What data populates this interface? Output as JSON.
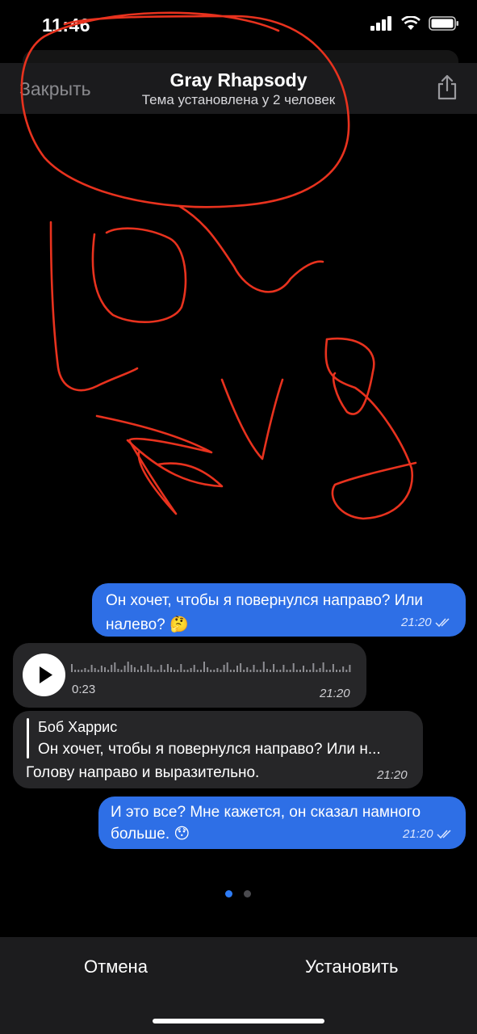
{
  "status_bar": {
    "time": "11:46"
  },
  "header": {
    "close_label": "Закрыть",
    "title": "Gray Rhapsody",
    "subtitle": "Тема установлена у 2 человек"
  },
  "messages": {
    "m1": {
      "text": "Он хочет, чтобы я повернулся направо? Или налево? 🤔",
      "time": "21:20"
    },
    "voice": {
      "duration": "0:23",
      "time": "21:20"
    },
    "reply": {
      "author": "Боб Харрис",
      "quote": "Он хочет, чтобы я повернулся направо? Или н...",
      "text": "Голову направо и выразительно.",
      "time": "21:20"
    },
    "m2": {
      "text": "И это все? Мне кажется, он сказал намного больше. 😯",
      "time": "21:20"
    }
  },
  "pager": {
    "page": 1,
    "total": 2
  },
  "bottom": {
    "cancel_label": "Отмена",
    "set_label": "Установить"
  },
  "colors": {
    "accent": "#2e6fe6",
    "drawing": "#e8321e",
    "bubble_in": "#262628"
  }
}
